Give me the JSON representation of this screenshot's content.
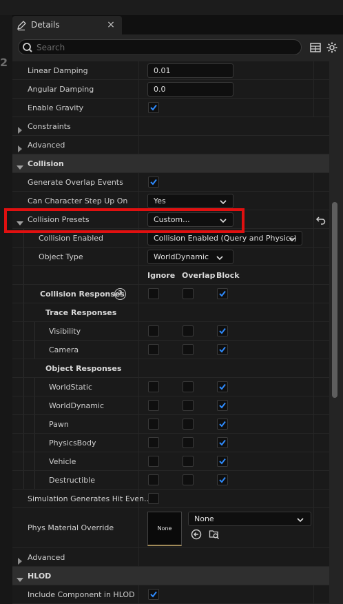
{
  "leftgutter": {
    "number": "2"
  },
  "tab": {
    "title": "Details",
    "close": "×",
    "icon": "details-pencil-icon"
  },
  "search": {
    "placeholder": "Search",
    "value": ""
  },
  "toolbar": {
    "table_icon": "table-view-icon",
    "settings_icon": "gear-icon"
  },
  "physics": {
    "linear_damping": {
      "label": "Linear Damping",
      "value": "0.01"
    },
    "angular_damping": {
      "label": "Angular Damping",
      "value": "0.0"
    },
    "enable_gravity": {
      "label": "Enable Gravity",
      "checked": true
    },
    "constraints": "Constraints",
    "advanced": "Advanced"
  },
  "collision": {
    "header": "Collision",
    "generate_overlap": {
      "label": "Generate Overlap Events",
      "checked": true
    },
    "step_up": {
      "label": "Can Character Step Up On",
      "value": "Yes"
    },
    "presets": {
      "label": "Collision Presets",
      "value": "Custom..."
    },
    "enabled": {
      "label": "Collision Enabled",
      "value": "Collision Enabled (Query and Physics)"
    },
    "object_type": {
      "label": "Object Type",
      "value": "WorldDynamic"
    },
    "columns": {
      "ignore": "Ignore",
      "overlap": "Overlap",
      "block": "Block"
    },
    "responses": {
      "label": "Collision Responses",
      "help": "?"
    },
    "trace_header": "Trace Responses",
    "trace": [
      {
        "name": "Visibility",
        "ignore": false,
        "overlap": false,
        "block": true
      },
      {
        "name": "Camera",
        "ignore": false,
        "overlap": false,
        "block": true
      }
    ],
    "object_header": "Object Responses",
    "objects": [
      {
        "name": "WorldStatic",
        "ignore": false,
        "overlap": false,
        "block": true
      },
      {
        "name": "WorldDynamic",
        "ignore": false,
        "overlap": false,
        "block": true
      },
      {
        "name": "Pawn",
        "ignore": false,
        "overlap": false,
        "block": true
      },
      {
        "name": "PhysicsBody",
        "ignore": false,
        "overlap": false,
        "block": true
      },
      {
        "name": "Vehicle",
        "ignore": false,
        "overlap": false,
        "block": true
      },
      {
        "name": "Destructible",
        "ignore": false,
        "overlap": false,
        "block": true
      }
    ],
    "sim_hit": {
      "label": "Simulation Generates Hit Even...",
      "checked": false
    },
    "phys_material": {
      "label": "Phys Material Override",
      "thumb": "None",
      "value": "None"
    },
    "advanced": "Advanced"
  },
  "hlod": {
    "header": "HLOD",
    "include": {
      "label": "Include Component in HLOD",
      "checked": true
    }
  },
  "colors": {
    "accent_check": "#2f8cff",
    "highlight_box": "#e01010"
  }
}
